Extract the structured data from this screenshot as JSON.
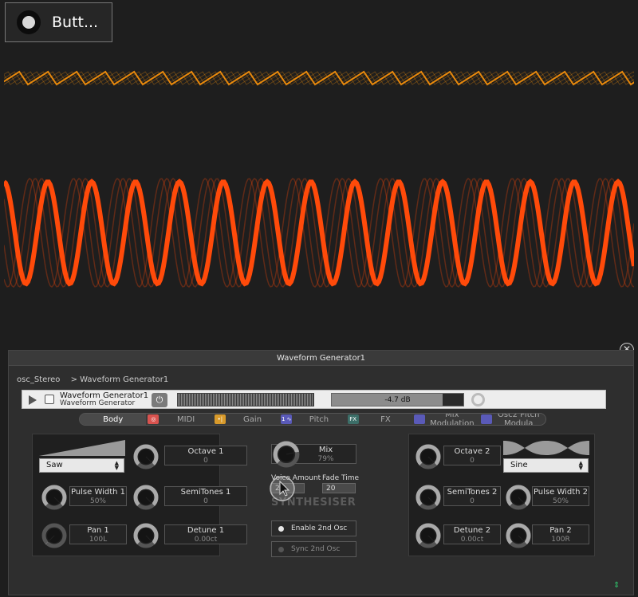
{
  "top_button": {
    "label": "Butt..."
  },
  "panel": {
    "title": "Waveform Generator1",
    "breadcrumb": [
      "osc_Stereo",
      "> Waveform Generator1"
    ],
    "device": {
      "name": "Waveform Generator1",
      "subtitle": "Waveform Generator",
      "gain_readout": "-4.7 dB"
    },
    "tabs": [
      {
        "label": "Body",
        "icon": "",
        "icon_color": ""
      },
      {
        "label": "MIDI",
        "icon": "◎",
        "icon_color": "#d9534f"
      },
      {
        "label": "Gain",
        "icon": "•|",
        "icon_color": "#d89a2b"
      },
      {
        "label": "Pitch",
        "icon": "1 ∿",
        "icon_color": "#5a5ab8"
      },
      {
        "label": "FX",
        "icon": "FX",
        "icon_color": "#3c6e68"
      },
      {
        "label": "Mix Modulation",
        "icon": "",
        "icon_color": "#5a5ab8"
      },
      {
        "label": "Osc2 Pitch Modula",
        "icon": "",
        "icon_color": "#5a5ab8"
      }
    ],
    "left": {
      "waveform_select": "Saw",
      "params": {
        "octave": {
          "name": "Octave 1",
          "value": "0"
        },
        "pulse_width": {
          "name": "Pulse Width 1",
          "value": "50%"
        },
        "semitones": {
          "name": "SemiTones 1",
          "value": "0"
        },
        "pan": {
          "name": "Pan 1",
          "value": "100L"
        },
        "detune": {
          "name": "Detune 1",
          "value": "0.00ct"
        }
      }
    },
    "center": {
      "mix": {
        "name": "Mix",
        "value": "79%"
      },
      "voice_amount": {
        "name": "Voice Amount",
        "value": "25"
      },
      "fade_time": {
        "name": "Fade Time",
        "value": "20"
      },
      "synth_label": "SYNTHESISER",
      "enable_2nd_osc": "Enable 2nd Osc",
      "sync_2nd_osc": "Sync 2nd Osc"
    },
    "right": {
      "waveform_select": "Sine",
      "params": {
        "octave": {
          "name": "Octave 2",
          "value": "0"
        },
        "semitones": {
          "name": "SemiTones 2",
          "value": "0"
        },
        "pulse_width": {
          "name": "Pulse Width 2",
          "value": "50%"
        },
        "detune": {
          "name": "Detune 2",
          "value": "0.00ct"
        },
        "pan": {
          "name": "Pan 2",
          "value": "100R"
        }
      }
    }
  },
  "colors": {
    "saw_wave": "#e8890c",
    "sine_wave": "#ff4a0a",
    "knob_ring": "#aaaaaa"
  }
}
